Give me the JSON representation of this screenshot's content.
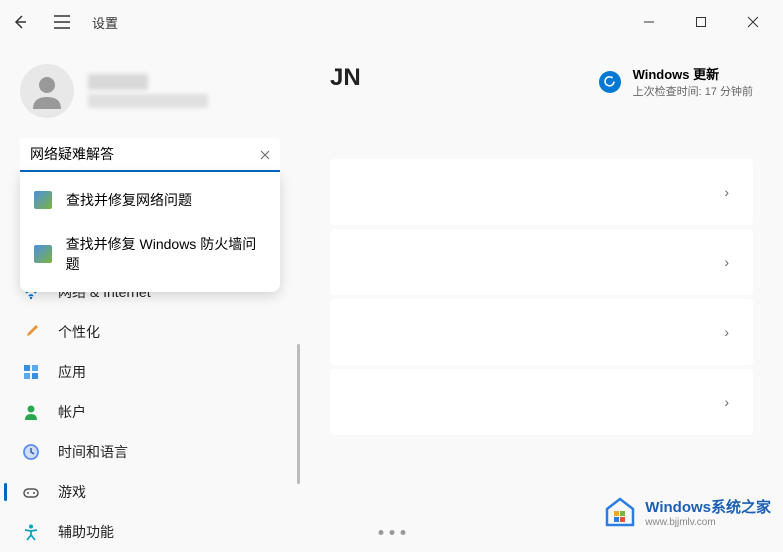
{
  "titlebar": {
    "app_title": "设置"
  },
  "user": {
    "name": "",
    "email": ""
  },
  "search": {
    "value": "网络疑难解答",
    "results": [
      {
        "label": "查找并修复网络问题"
      },
      {
        "label": "查找并修复 Windows 防火墙问题"
      }
    ]
  },
  "nav": {
    "items": [
      {
        "label": "网络 & Internet",
        "icon": "wifi",
        "color": "#0078d4"
      },
      {
        "label": "个性化",
        "icon": "brush",
        "color": "#e8943a"
      },
      {
        "label": "应用",
        "icon": "apps",
        "color": "#3a8fd8"
      },
      {
        "label": "帐户",
        "icon": "person",
        "color": "#2aa84f"
      },
      {
        "label": "时间和语言",
        "icon": "clock",
        "color": "#5b8def"
      },
      {
        "label": "游戏",
        "icon": "gamepad",
        "color": "#777"
      },
      {
        "label": "辅助功能",
        "icon": "accessibility",
        "color": "#0aa2c0"
      }
    ]
  },
  "main": {
    "title_suffix": "JN",
    "update": {
      "title": "Windows 更新",
      "subtitle": "上次检查时间: 17 分钟前"
    }
  },
  "watermark": {
    "main": "Windows系统之家",
    "sub": "www.bjjmlv.com"
  }
}
